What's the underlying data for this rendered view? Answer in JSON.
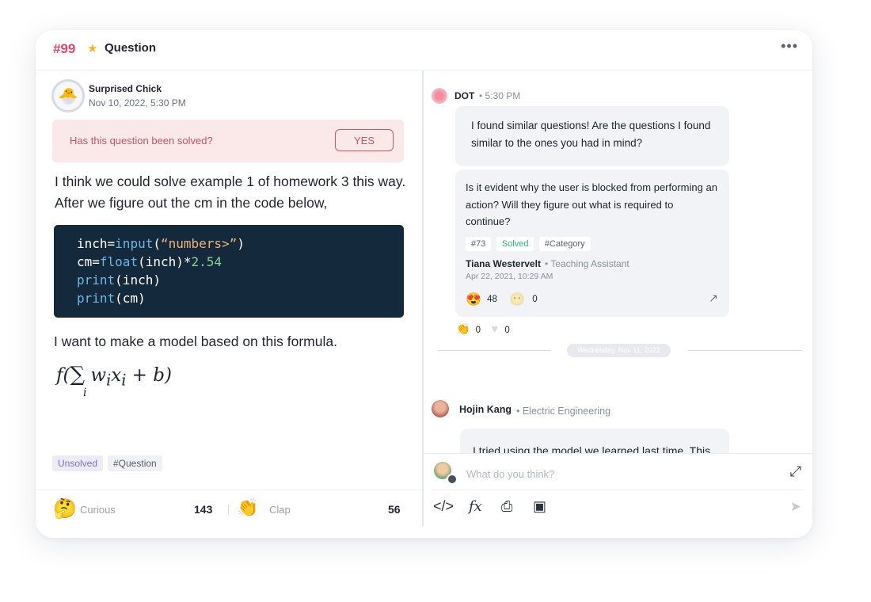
{
  "header": {
    "number": "#99",
    "star_icon": "star-icon",
    "title": "Question",
    "more_icon": "more-dots-icon"
  },
  "post": {
    "author": "Surprised Chick",
    "date": "Nov 10, 2022, 5:30 PM",
    "solved_question": "Has this question been solved?",
    "yes_label": "YES",
    "body_text": "I think we could solve example 1 of homework 3 this way. After we figure out the cm in the code below,",
    "code_lines": [
      "inch=input(“numbers>”)",
      "cm=float(inch)*2.54",
      "print(inch)",
      "print(cm)"
    ],
    "body_text2": "I want to make a model based on this formula.",
    "formula": "f(∑ᵢ wᵢxᵢ + b)",
    "tags": [
      "Unsolved",
      "#Question"
    ],
    "reactions": [
      {
        "icon": "curious-emoji-icon",
        "label": "Curious",
        "count": "143"
      },
      {
        "icon": "clap-icon",
        "label": "Clap",
        "count": "56"
      }
    ]
  },
  "chat": {
    "dot": {
      "name": "DOT",
      "time": "• 5:30 PM",
      "message": "I found similar questions! Are the questions I found similar to the ones you had in mind?"
    },
    "related": {
      "text": "Is it evident why the user is blocked from performing an action? Will they figure out what is required to continue?",
      "tags": [
        "#73",
        "Solved",
        "#Category"
      ],
      "author": "Tiana Westervelt",
      "role": "• Teaching Assistant",
      "date": "Apr 22, 2021, 10:29 AM",
      "reactions": [
        {
          "icon": "heart-eyes-emoji-icon",
          "count": "48"
        },
        {
          "icon": "neutral-emoji-icon",
          "count": "0"
        }
      ]
    },
    "after_reactions": [
      {
        "icon": "clap-icon",
        "count": "0"
      },
      {
        "icon": "heart-icon",
        "count": "0"
      }
    ],
    "day_separator": "Wednesday, Nov 11, 2022",
    "hojin": {
      "name": "Hojin Kang",
      "dept": "• Electric Engineering",
      "message": "I tried using the model we learned last time. This is how it turned out..."
    }
  },
  "composer": {
    "placeholder": "What do you think?",
    "tools": [
      "code-icon",
      "formula-icon",
      "attachment-icon",
      "image-icon"
    ],
    "expand_icon": "expand-icon",
    "send_icon": "send-icon"
  }
}
